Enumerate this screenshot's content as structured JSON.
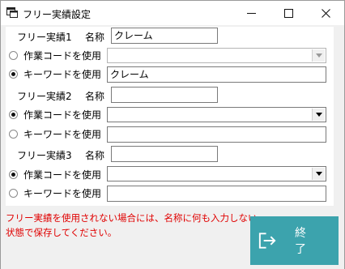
{
  "window": {
    "title": "フリー実績設定",
    "minimize_icon": "minimize-icon",
    "maximize_icon": "maximize-icon",
    "close_icon": "close-icon"
  },
  "labels": {
    "name": "名称",
    "use_work_code": "作業コードを使用",
    "use_keyword": "キーワードを使用"
  },
  "groups": [
    {
      "title": "フリー実績1",
      "name_value": "クレーム",
      "mode": "keyword",
      "work_code_value": "",
      "keyword_value": "クレーム"
    },
    {
      "title": "フリー実績2",
      "name_value": "",
      "mode": "work_code",
      "work_code_value": "",
      "keyword_value": ""
    },
    {
      "title": "フリー実績3",
      "name_value": "",
      "mode": "work_code",
      "work_code_value": "",
      "keyword_value": ""
    }
  ],
  "note": {
    "line1": "フリー実績を使用されない場合には、名称に何も入力しない",
    "line2": "状態で保存してください。"
  },
  "end_button": {
    "label": "終了",
    "icon": "exit-icon"
  },
  "colors": {
    "accent": "#3ca3ad",
    "note_text": "#e00000",
    "group_bg": "#ffffff",
    "window_bg": "#f0f0f0"
  }
}
